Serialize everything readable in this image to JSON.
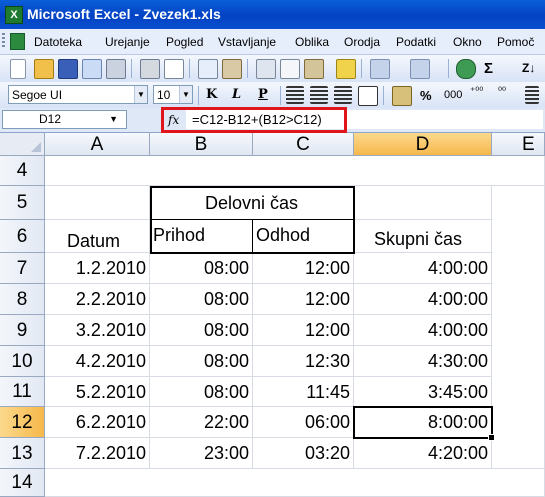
{
  "window": {
    "title": "Microsoft Excel - Zvezek1.xls",
    "app_icon": "X"
  },
  "menu": {
    "items": [
      "Datoteka",
      "Urejanje",
      "Pogled",
      "Vstavljanje",
      "Oblika",
      "Orodja",
      "Podatki",
      "Okno",
      "Pomoč"
    ]
  },
  "toolbar": {
    "sum_label": "Σ",
    "sort_label": "Z↓"
  },
  "format_toolbar": {
    "font": "Segoe UI",
    "size": "10",
    "bold": "K",
    "italic": "L",
    "underline": "P",
    "percent": "%",
    "thousands": "000",
    "inc_decimal": "⁺⁰⁰",
    "dec_decimal": "⁰⁰"
  },
  "formula_bar": {
    "name_box": "D12",
    "fx": "fx",
    "formula": "=C12-B12+(B12>C12)",
    "highlight_color": "#e0151b"
  },
  "sheet": {
    "columns": [
      "A",
      "B",
      "C",
      "D",
      "E"
    ],
    "selected_column": "D",
    "selected_row": "12",
    "rows": [
      "4",
      "5",
      "6",
      "7",
      "8",
      "9",
      "10",
      "11",
      "12",
      "13",
      "14"
    ],
    "header_group": "Delovni čas",
    "headers": {
      "date": "Datum",
      "arrival": "Prihod",
      "departure": "Odhod",
      "total": "Skupni čas"
    },
    "data": [
      {
        "row": "7",
        "date": "1.2.2010",
        "arrival": "08:00",
        "departure": "12:00",
        "total": "4:00:00"
      },
      {
        "row": "8",
        "date": "2.2.2010",
        "arrival": "08:00",
        "departure": "12:00",
        "total": "4:00:00"
      },
      {
        "row": "9",
        "date": "3.2.2010",
        "arrival": "08:00",
        "departure": "12:00",
        "total": "4:00:00"
      },
      {
        "row": "10",
        "date": "4.2.2010",
        "arrival": "08:00",
        "departure": "12:30",
        "total": "4:30:00"
      },
      {
        "row": "11",
        "date": "5.2.2010",
        "arrival": "08:00",
        "departure": "11:45",
        "total": "3:45:00"
      },
      {
        "row": "12",
        "date": "6.2.2010",
        "arrival": "22:00",
        "departure": "06:00",
        "total": "8:00:00"
      },
      {
        "row": "13",
        "date": "7.2.2010",
        "arrival": "23:00",
        "departure": "03:20",
        "total": "4:20:00"
      }
    ],
    "selection_color": "#f6b84b"
  }
}
